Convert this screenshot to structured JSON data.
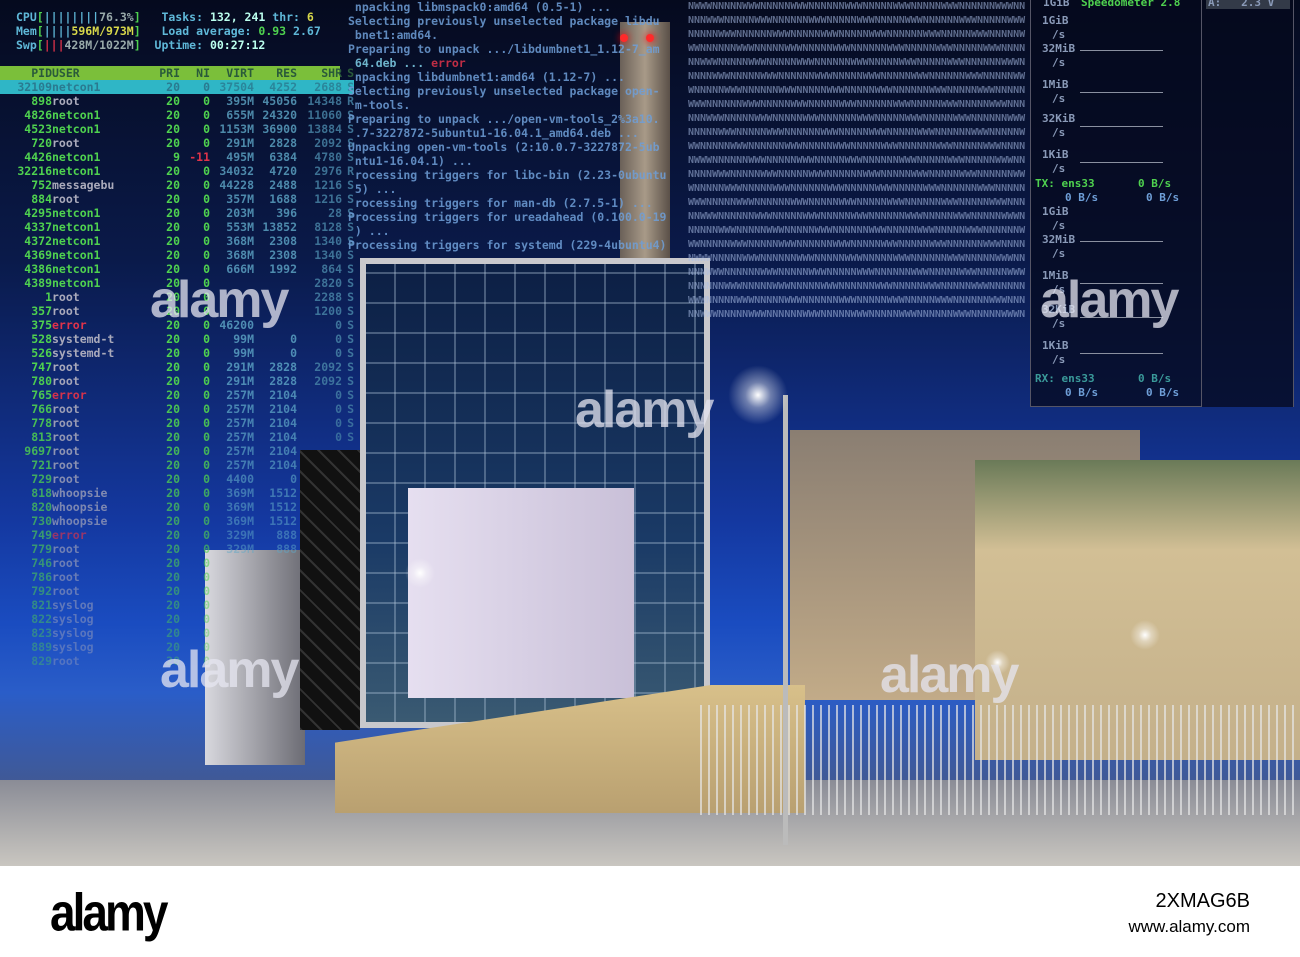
{
  "htop": {
    "cpu_label": "CPU",
    "cpu_pct": "76.3%",
    "mem_label": "Mem",
    "mem_value": "596M/973M",
    "swp_label": "Swp",
    "swp_value": "428M/1022M",
    "tasks_label": "Tasks:",
    "tasks_value": "132, 241",
    "thr_label": "thr:",
    "thr_value": "6",
    "load_label": "Load average:",
    "load_1": "0.93",
    "load_5": "2.67",
    "uptime_label": "Uptime:",
    "uptime_value": "00:27:12",
    "columns": [
      "PID",
      "USER",
      "PRI",
      "NI",
      "VIRT",
      "RES",
      "SHR",
      "S"
    ],
    "rows": [
      [
        "32109",
        "netcon1",
        "20",
        "0",
        "37504",
        "4252",
        "2688",
        "S"
      ],
      [
        "898",
        "root",
        "20",
        "0",
        "395M",
        "45056",
        "14348",
        "R"
      ],
      [
        "4826",
        "netcon1",
        "20",
        "0",
        "655M",
        "24320",
        "11060",
        "S"
      ],
      [
        "4523",
        "netcon1",
        "20",
        "0",
        "1153M",
        "36900",
        "13884",
        "S"
      ],
      [
        "720",
        "root",
        "20",
        "0",
        "291M",
        "2828",
        "2092",
        "S"
      ],
      [
        "4426",
        "netcon1",
        "9",
        "-11",
        "495M",
        "6384",
        "4780",
        "S"
      ],
      [
        "32216",
        "netcon1",
        "20",
        "0",
        "34032",
        "4720",
        "2976",
        "R"
      ],
      [
        "752",
        "messagebu",
        "20",
        "0",
        "44228",
        "2488",
        "1216",
        "S"
      ],
      [
        "884",
        "root",
        "20",
        "0",
        "357M",
        "1688",
        "1216",
        "S"
      ],
      [
        "4295",
        "netcon1",
        "20",
        "0",
        "203M",
        "396",
        "28",
        "S"
      ],
      [
        "4337",
        "netcon1",
        "20",
        "0",
        "553M",
        "13852",
        "8128",
        "S"
      ],
      [
        "4372",
        "netcon1",
        "20",
        "0",
        "368M",
        "2308",
        "1340",
        "S"
      ],
      [
        "4369",
        "netcon1",
        "20",
        "0",
        "368M",
        "2308",
        "1340",
        "S"
      ],
      [
        "4386",
        "netcon1",
        "20",
        "0",
        "666M",
        "1992",
        "864",
        "S"
      ],
      [
        "4389",
        "netcon1",
        "20",
        "0",
        "",
        "",
        "2820",
        "S"
      ],
      [
        "1",
        "root",
        "20",
        "0",
        "",
        "",
        "2288",
        "S"
      ],
      [
        "357",
        "root",
        "20",
        "0",
        "",
        "",
        "1200",
        "S"
      ],
      [
        "375",
        "error",
        "20",
        "0",
        "46200",
        "",
        "0",
        "S"
      ],
      [
        "528",
        "systemd-t",
        "20",
        "0",
        "99M",
        "0",
        "0",
        "S"
      ],
      [
        "526",
        "systemd-t",
        "20",
        "0",
        "99M",
        "0",
        "0",
        "S"
      ],
      [
        "747",
        "root",
        "20",
        "0",
        "291M",
        "2828",
        "2092",
        "S"
      ],
      [
        "780",
        "root",
        "20",
        "0",
        "291M",
        "2828",
        "2092",
        "S"
      ],
      [
        "765",
        "error",
        "20",
        "0",
        "257M",
        "2104",
        "0",
        "S"
      ],
      [
        "766",
        "root",
        "20",
        "0",
        "257M",
        "2104",
        "0",
        "S"
      ],
      [
        "778",
        "root",
        "20",
        "0",
        "257M",
        "2104",
        "0",
        "S"
      ],
      [
        "813",
        "root",
        "20",
        "0",
        "257M",
        "2104",
        "0",
        "S"
      ],
      [
        "9697",
        "root",
        "20",
        "0",
        "257M",
        "2104",
        "",
        ""
      ],
      [
        "721",
        "root",
        "20",
        "0",
        "257M",
        "2104",
        "",
        ""
      ],
      [
        "729",
        "root",
        "20",
        "0",
        "4400",
        "0",
        "",
        ""
      ],
      [
        "818",
        "whoopsie",
        "20",
        "0",
        "369M",
        "1512",
        "",
        ""
      ],
      [
        "820",
        "whoopsie",
        "20",
        "0",
        "369M",
        "1512",
        "",
        ""
      ],
      [
        "730",
        "whoopsie",
        "20",
        "0",
        "369M",
        "1512",
        "",
        ""
      ],
      [
        "749",
        "error",
        "20",
        "0",
        "329M",
        "888",
        "",
        ""
      ],
      [
        "779",
        "root",
        "20",
        "0",
        "329M",
        "888",
        "",
        ""
      ],
      [
        "746",
        "root",
        "20",
        "0",
        "",
        "",
        "",
        ""
      ],
      [
        "786",
        "root",
        "20",
        "0",
        "",
        "",
        "",
        ""
      ],
      [
        "792",
        "root",
        "20",
        "0",
        "",
        "",
        "",
        ""
      ],
      [
        "821",
        "syslog",
        "20",
        "0",
        "",
        "",
        "",
        ""
      ],
      [
        "822",
        "syslog",
        "20",
        "0",
        "",
        "",
        "",
        ""
      ],
      [
        "823",
        "syslog",
        "20",
        "0",
        "",
        "",
        "",
        ""
      ],
      [
        "889",
        "syslog",
        "20",
        "0",
        "",
        "",
        "",
        ""
      ],
      [
        "829",
        "root",
        "20",
        "0",
        "",
        "",
        "",
        ""
      ]
    ]
  },
  "apt_log": [
    " npacking libmspack0:amd64 (0.5-1) ...",
    "Selecting previously unselected package libdu",
    " bnet1:amd64.",
    "Preparing to unpack .../libdumbnet1_1.12-7_am",
    " 64.deb ... error",
    " npacking libdumbnet1:amd64 (1.12-7) ...",
    "Selecting previously unselected package open-",
    " m-tools.",
    "Preparing to unpack .../open-vm-tools_2%3a10.",
    " .7-3227872-5ubuntu1-16.04.1_amd64.deb ...",
    "Unpacking open-vm-tools (2:10.0.7-3227872-5ub",
    " ntu1-16.04.1) ...",
    " rocessing triggers for libc-bin (2.23-0ubuntu",
    " 5) ...",
    " rocessing triggers for man-db (2.7.5-1) ...",
    "Processing triggers for ureadahead (0.100.0-19",
    " ) ...",
    "Processing triggers for systemd (229-4ubuntu4)"
  ],
  "speedometer": {
    "title": "Speedometer 2.8",
    "voltage_label": "A:",
    "voltage_value": "2.3 V",
    "scale": [
      "1GiB",
      "/s",
      "32MiB",
      "/s",
      "1MiB",
      "/s",
      "32KiB",
      "/s",
      "1KiB",
      "/s"
    ],
    "tx_label": "TX: ens33",
    "tx_rate": "0 B/s",
    "tx_sub1": "0 B/s",
    "tx_sub2": "0 B/s",
    "rx_label": "RX: ens33",
    "rx_rate": "0 B/s",
    "rx_sub1": "0 B/s",
    "rx_sub2": "0 B/s"
  },
  "watermark": "alamy",
  "footer": {
    "logo": "alamy",
    "image_id": "2XMAG6B",
    "url": "www.alamy.com"
  }
}
